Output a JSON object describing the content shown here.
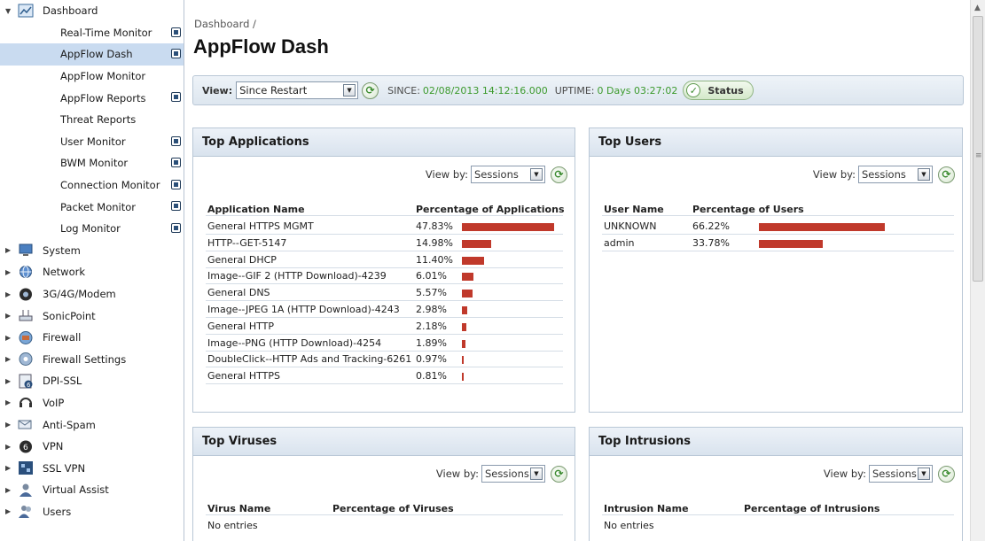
{
  "sidebar": {
    "items": [
      {
        "label": "Dashboard",
        "kind": "parent",
        "expanded": true,
        "icon": "dashboard-icon"
      },
      {
        "label": "Real-Time Monitor",
        "kind": "child",
        "ext": true
      },
      {
        "label": "AppFlow Dash",
        "kind": "child",
        "ext": true,
        "selected": true
      },
      {
        "label": "AppFlow Monitor",
        "kind": "child",
        "ext": false
      },
      {
        "label": "AppFlow Reports",
        "kind": "child",
        "ext": true
      },
      {
        "label": "Threat Reports",
        "kind": "child",
        "ext": false
      },
      {
        "label": "User Monitor",
        "kind": "child",
        "ext": true
      },
      {
        "label": "BWM Monitor",
        "kind": "child",
        "ext": true
      },
      {
        "label": "Connection Monitor",
        "kind": "child",
        "ext": true
      },
      {
        "label": "Packet Monitor",
        "kind": "child",
        "ext": true
      },
      {
        "label": "Log Monitor",
        "kind": "child",
        "ext": true
      },
      {
        "label": "System",
        "kind": "parent",
        "icon": "system-monitor-icon"
      },
      {
        "label": "Network",
        "kind": "parent",
        "icon": "network-globe-icon"
      },
      {
        "label": "3G/4G/Modem",
        "kind": "parent",
        "icon": "modem-icon"
      },
      {
        "label": "SonicPoint",
        "kind": "parent",
        "icon": "access-point-icon"
      },
      {
        "label": "Firewall",
        "kind": "parent",
        "icon": "firewall-icon"
      },
      {
        "label": "Firewall Settings",
        "kind": "parent",
        "icon": "firewall-settings-icon"
      },
      {
        "label": "DPI-SSL",
        "kind": "parent",
        "icon": "dpi-ssl-icon"
      },
      {
        "label": "VoIP",
        "kind": "parent",
        "icon": "headset-icon"
      },
      {
        "label": "Anti-Spam",
        "kind": "parent",
        "icon": "anti-spam-icon"
      },
      {
        "label": "VPN",
        "kind": "parent",
        "icon": "vpn-icon"
      },
      {
        "label": "SSL VPN",
        "kind": "parent",
        "icon": "ssl-vpn-icon"
      },
      {
        "label": "Virtual Assist",
        "kind": "parent",
        "icon": "virtual-assist-icon"
      },
      {
        "label": "Users",
        "kind": "parent",
        "icon": "users-icon"
      }
    ]
  },
  "header": {
    "breadcrumb": "Dashboard /",
    "title": "AppFlow Dash"
  },
  "viewbar": {
    "view_label": "View:",
    "view_value": "Since Restart",
    "since_label": "SINCE:",
    "since_value": "02/08/2013 14:12:16.000",
    "uptime_label": "UPTIME:",
    "uptime_value": "0 Days 03:27:02",
    "status_label": "Status"
  },
  "panels": {
    "top_apps": {
      "title": "Top Applications",
      "viewby_label": "View by:",
      "viewby_value": "Sessions",
      "col1": "Application Name",
      "col2": "Percentage of Applications",
      "rows": [
        {
          "name": "General HTTPS MGMT",
          "pct": "47.83%",
          "value": 47.83
        },
        {
          "name": "HTTP--GET-5147",
          "pct": "14.98%",
          "value": 14.98
        },
        {
          "name": "General DHCP",
          "pct": "11.40%",
          "value": 11.4
        },
        {
          "name": "Image--GIF 2 (HTTP Download)-4239",
          "pct": "6.01%",
          "value": 6.01
        },
        {
          "name": "General DNS",
          "pct": "5.57%",
          "value": 5.57
        },
        {
          "name": "Image--JPEG 1A (HTTP Download)-4243",
          "pct": "2.98%",
          "value": 2.98
        },
        {
          "name": "General HTTP",
          "pct": "2.18%",
          "value": 2.18
        },
        {
          "name": "Image--PNG (HTTP Download)-4254",
          "pct": "1.89%",
          "value": 1.89
        },
        {
          "name": "DoubleClick--HTTP Ads and Tracking-6261",
          "pct": "0.97%",
          "value": 0.97
        },
        {
          "name": "General HTTPS",
          "pct": "0.81%",
          "value": 0.81
        }
      ]
    },
    "top_users": {
      "title": "Top Users",
      "viewby_label": "View by:",
      "viewby_value": "Sessions",
      "col1": "User Name",
      "col2": "Percentage of Users",
      "rows": [
        {
          "name": "UNKNOWN",
          "pct": "66.22%",
          "value": 66.22
        },
        {
          "name": "admin",
          "pct": "33.78%",
          "value": 33.78
        }
      ]
    },
    "top_viruses": {
      "title": "Top Viruses",
      "viewby_label": "View by:",
      "viewby_value": "Sessions",
      "col1": "Virus Name",
      "col2": "Percentage of Viruses",
      "empty": "No entries"
    },
    "top_intrusions": {
      "title": "Top Intrusions",
      "viewby_label": "View by:",
      "viewby_value": "Sessions",
      "col1": "Intrusion Name",
      "col2": "Percentage of Intrusions",
      "empty": "No entries"
    }
  },
  "colors": {
    "bar": "#c0392b",
    "selected": "#c9dbf0",
    "green_text": "#3c9a2d"
  }
}
